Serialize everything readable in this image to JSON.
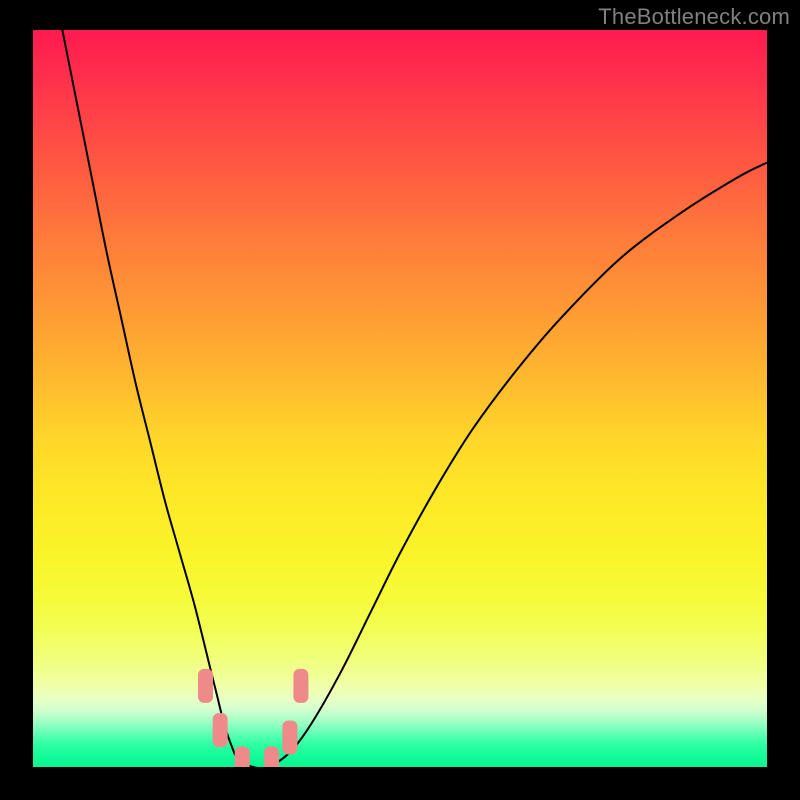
{
  "watermark": "TheBottleneck.com",
  "chart_data": {
    "type": "line",
    "title": "",
    "xlabel": "",
    "ylabel": "",
    "xlim": [
      0,
      100
    ],
    "ylim": [
      0,
      100
    ],
    "series": [
      {
        "name": "curve",
        "x": [
          4,
          5,
          6,
          8,
          10,
          12,
          14,
          16,
          18,
          20,
          22,
          24,
          25,
          26,
          27,
          28,
          30,
          32,
          35,
          38,
          42,
          46,
          50,
          55,
          60,
          66,
          72,
          80,
          88,
          96,
          100
        ],
        "y": [
          100,
          95,
          90,
          80,
          70,
          61,
          52,
          44,
          36,
          29,
          22,
          14,
          10,
          6,
          3,
          1,
          0,
          0,
          2,
          6,
          13,
          21,
          29,
          38,
          46,
          54,
          61,
          69,
          75,
          80,
          82
        ]
      }
    ],
    "markers": [
      {
        "x": 23.5,
        "y": 11
      },
      {
        "x": 25.5,
        "y": 5
      },
      {
        "x": 28.5,
        "y": 0.5
      },
      {
        "x": 32.5,
        "y": 0.5
      },
      {
        "x": 35.0,
        "y": 4
      },
      {
        "x": 36.5,
        "y": 11
      }
    ],
    "annotations": []
  }
}
